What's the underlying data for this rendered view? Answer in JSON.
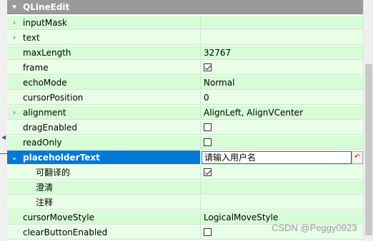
{
  "group": {
    "label": "QLineEdit"
  },
  "props": {
    "inputMask": {
      "name": "inputMask",
      "value": ""
    },
    "text": {
      "name": "text",
      "value": ""
    },
    "maxLength": {
      "name": "maxLength",
      "value": "32767"
    },
    "frame": {
      "name": "frame",
      "checked": true
    },
    "echoMode": {
      "name": "echoMode",
      "value": "Normal"
    },
    "cursorPosition": {
      "name": "cursorPosition",
      "value": "0"
    },
    "alignment": {
      "name": "alignment",
      "value": "AlignLeft, AlignVCenter"
    },
    "dragEnabled": {
      "name": "dragEnabled",
      "checked": false
    },
    "readOnly": {
      "name": "readOnly",
      "checked": false
    },
    "placeholderText": {
      "name": "placeholderText",
      "value": "请输入用户名"
    },
    "translatable": {
      "name": "可翻译的",
      "checked": true
    },
    "disambiguation": {
      "name": "澄清",
      "value": ""
    },
    "comment": {
      "name": "注释",
      "value": ""
    },
    "cursorMoveStyle": {
      "name": "cursorMoveStyle",
      "value": "LogicalMoveStyle"
    },
    "clearButtonEnabled": {
      "name": "clearButtonEnabled",
      "checked": false
    }
  },
  "icons": {
    "collapsed": "chevron-right-icon",
    "expanded": "chevron-down-icon",
    "reset": "reset-arrow-icon"
  },
  "colors": {
    "selected": "#0078d7",
    "row_alt": "#d7fdd7",
    "row_plain": "#e9ffe7",
    "group_header": "#9a9a9a"
  },
  "watermark": "CSDN @Peggy0923"
}
